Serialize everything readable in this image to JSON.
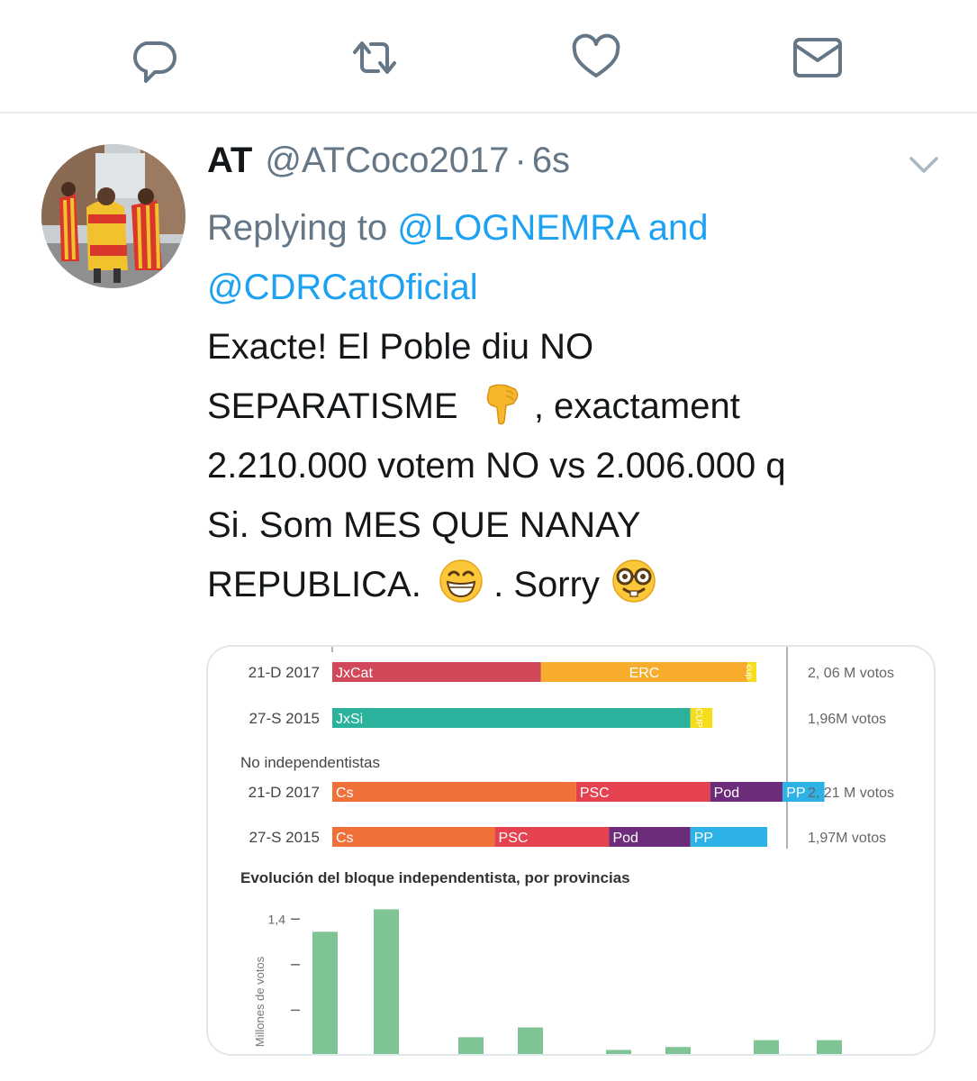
{
  "actions": {
    "reply_icon": "reply-icon",
    "retweet_icon": "retweet-icon",
    "like_icon": "heart-icon",
    "dm_icon": "envelope-icon",
    "icon_color": "#657786"
  },
  "tweet": {
    "display_name": "AT",
    "handle": "@ATCoco2017",
    "separator": "·",
    "time": "6s",
    "replying_prefix": "Replying to",
    "mention_1": "@LOGNEMRA",
    "and": "and",
    "mention_2": "@CDRCatOficial",
    "text_line_1": "Exacte! El Poble diu NO",
    "text_line_2a": "SEPARATISME",
    "text_line_2b": ", exactament",
    "text_line_3": "2.210.000 votem NO vs 2.006.000 q",
    "text_line_4": "Si. Som MES QUE NANAY",
    "text_line_5a": "REPUBLICA.",
    "text_line_5b": ". Sorry",
    "emoji_1": "backhand-index-pointing-down",
    "emoji_2": "grinning-face-with-smiling-eyes",
    "emoji_3": "nerd-face",
    "link_color": "#1da1f2"
  },
  "chart_data": [
    {
      "type": "bar",
      "orientation": "horizontal-stacked",
      "rows": [
        {
          "label": "21-D 2017",
          "total_label": "2, 06 M votos",
          "segments": [
            {
              "name": "JxCat",
              "value": 0.95,
              "color": "#d0485a"
            },
            {
              "name": "ERC",
              "value": 0.94,
              "color": "#f7ad2b"
            },
            {
              "name": "cup",
              "value": 0.04,
              "color": "#f5dd1c"
            }
          ]
        },
        {
          "label": "27-S 2015",
          "total_label": "1,96M votos",
          "segments": [
            {
              "name": "JxSi",
              "value": 1.63,
              "color": "#2ab29c"
            },
            {
              "name": "CUP",
              "value": 0.1,
              "color": "#f5dd1c"
            }
          ]
        }
      ],
      "section_title": "No independentistas",
      "rows_2": [
        {
          "label": "21-D 2017",
          "total_label": "2, 21 M votos",
          "segments": [
            {
              "name": "Cs",
              "value": 1.11,
              "color": "#f0703a"
            },
            {
              "name": "PSC",
              "value": 0.61,
              "color": "#e4424e"
            },
            {
              "name": "Pod",
              "value": 0.33,
              "color": "#6d2c7a"
            },
            {
              "name": "PP",
              "value": 0.19,
              "color": "#2cb2e4"
            }
          ]
        },
        {
          "label": "27-S 2015",
          "total_label": "1,97M votos",
          "segments": [
            {
              "name": "Cs",
              "value": 0.74,
              "color": "#f0703a"
            },
            {
              "name": "PSC",
              "value": 0.52,
              "color": "#e4424e"
            },
            {
              "name": "Pod",
              "value": 0.37,
              "color": "#6d2c7a"
            },
            {
              "name": "PP",
              "value": 0.35,
              "color": "#2cb2e4"
            }
          ]
        }
      ]
    },
    {
      "type": "bar",
      "title": "Evolución del bloque independentista, por provincias",
      "ylabel": "Millones de votos",
      "ytick_label": "1,4",
      "ylim": [
        0,
        1.55
      ],
      "values": [
        1.27,
        1.5,
        0.19,
        0.29,
        0.06,
        0.09,
        0.16,
        0.16
      ],
      "color": "#7ec494"
    }
  ]
}
